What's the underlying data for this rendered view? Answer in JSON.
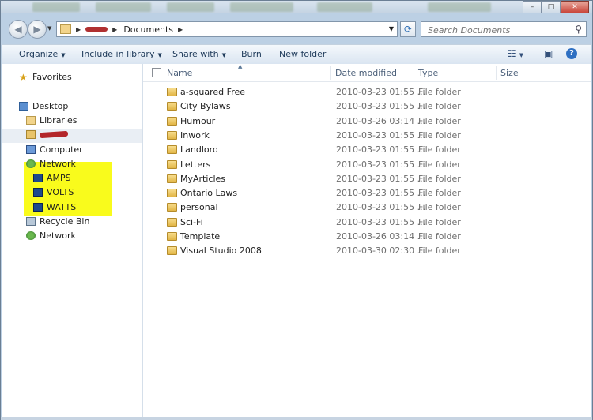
{
  "address": {
    "crumbs": [
      "Documents"
    ]
  },
  "search": {
    "placeholder": "Search Documents"
  },
  "toolbar": {
    "organize": "Organize",
    "include_in_library": "Include in library",
    "share_with": "Share with",
    "burn": "Burn",
    "new_folder": "New folder"
  },
  "nav": {
    "favorites": "Favorites",
    "desktop": "Desktop",
    "libraries": "Libraries",
    "computer": "Computer",
    "network": "Network",
    "amps": "AMPS",
    "volts": "VOLTS",
    "watts": "WATTS",
    "recycle_bin": "Recycle Bin",
    "network2": "Network"
  },
  "columns": {
    "name": "Name",
    "date_modified": "Date modified",
    "type": "Type",
    "size": "Size"
  },
  "files": [
    {
      "name": "a-squared Free",
      "date": "2010-03-23 01:55 ...",
      "type": "File folder"
    },
    {
      "name": "City Bylaws",
      "date": "2010-03-23 01:55 ...",
      "type": "File folder"
    },
    {
      "name": "Humour",
      "date": "2010-03-26 03:14 ...",
      "type": "File folder"
    },
    {
      "name": "Inwork",
      "date": "2010-03-23 01:55 ...",
      "type": "File folder"
    },
    {
      "name": "Landlord",
      "date": "2010-03-23 01:55 ...",
      "type": "File folder"
    },
    {
      "name": "Letters",
      "date": "2010-03-23 01:55 ...",
      "type": "File folder"
    },
    {
      "name": "MyArticles",
      "date": "2010-03-23 01:55 ...",
      "type": "File folder"
    },
    {
      "name": "Ontario Laws",
      "date": "2010-03-23 01:55 ...",
      "type": "File folder"
    },
    {
      "name": "personal",
      "date": "2010-03-23 01:55 ...",
      "type": "File folder"
    },
    {
      "name": "Sci-Fi",
      "date": "2010-03-23 01:55 ...",
      "type": "File folder"
    },
    {
      "name": "Template",
      "date": "2010-03-26 03:14 ...",
      "type": "File folder"
    },
    {
      "name": "Visual Studio 2008",
      "date": "2010-03-30 02:30 ...",
      "type": "File folder"
    }
  ],
  "colors": {
    "highlight": "#f9fb1c",
    "toolbar_text": "#1e3a5a",
    "window_frame": "#bcd0e4"
  }
}
